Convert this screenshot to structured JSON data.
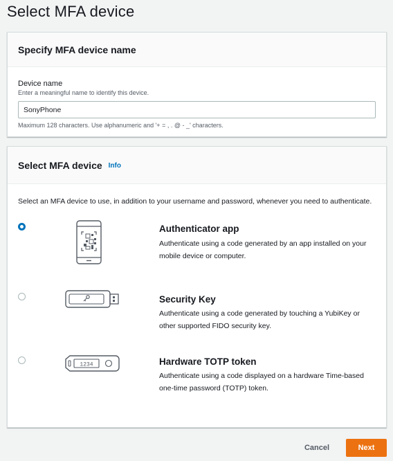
{
  "page": {
    "title": "Select MFA device"
  },
  "name_panel": {
    "heading": "Specify MFA device name",
    "field_label": "Device name",
    "field_description": "Enter a meaningful name to identify this device.",
    "field_value": "SonyPhone",
    "field_constraint": "Maximum 128 characters. Use alphanumeric and '+ = , . @ - _' characters."
  },
  "device_panel": {
    "heading": "Select MFA device",
    "info_link": "Info",
    "intro": "Select an MFA device to use, in addition to your username and password, whenever you need to authenticate.",
    "options": [
      {
        "title": "Authenticator app",
        "description": "Authenticate using a code generated by an app installed on your mobile device or computer.",
        "selected": true,
        "icon": "phone-qr-icon"
      },
      {
        "title": "Security Key",
        "description": "Authenticate using a code generated by touching a YubiKey or other supported FIDO security key.",
        "selected": false,
        "icon": "security-key-icon"
      },
      {
        "title": "Hardware TOTP token",
        "description": "Authenticate using a code displayed on a hardware Time-based one-time password (TOTP) token.",
        "selected": false,
        "icon": "totp-token-icon",
        "icon_display_text": "1234"
      }
    ]
  },
  "footer": {
    "cancel_label": "Cancel",
    "next_label": "Next"
  },
  "colors": {
    "accent": "#0073bb",
    "primary_button": "#ec7211",
    "background": "#f2f3f3"
  }
}
